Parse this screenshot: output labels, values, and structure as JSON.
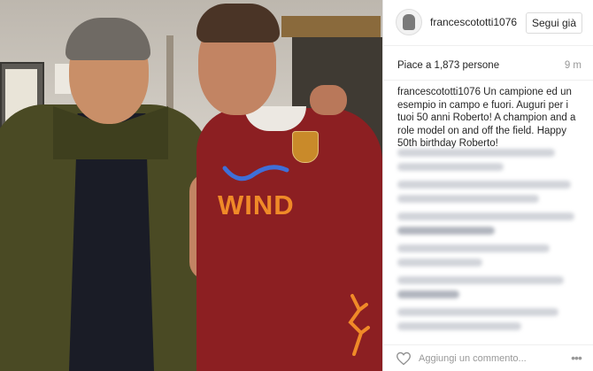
{
  "post": {
    "username": "francescototti1076",
    "follow_label": "Segui già",
    "likes": "Piace a 1,873 persone",
    "time": "9 m",
    "caption_username": "francescototti1076",
    "caption_text": " Un campione ed un esempio in campo e fuori. Auguri per i tuoi 50 anni Roberto! A champion and a role model on and off the field. Happy 50th birthday Roberto!",
    "comment_placeholder": "Aggiungi un commento...",
    "more_label": "•••"
  },
  "photo": {
    "jersey_text": "WIND"
  },
  "colors": {
    "jersey": "#8c1f22",
    "sponsor": "#f08a28",
    "jacket": "#4a4a24",
    "border": "#efefef"
  }
}
